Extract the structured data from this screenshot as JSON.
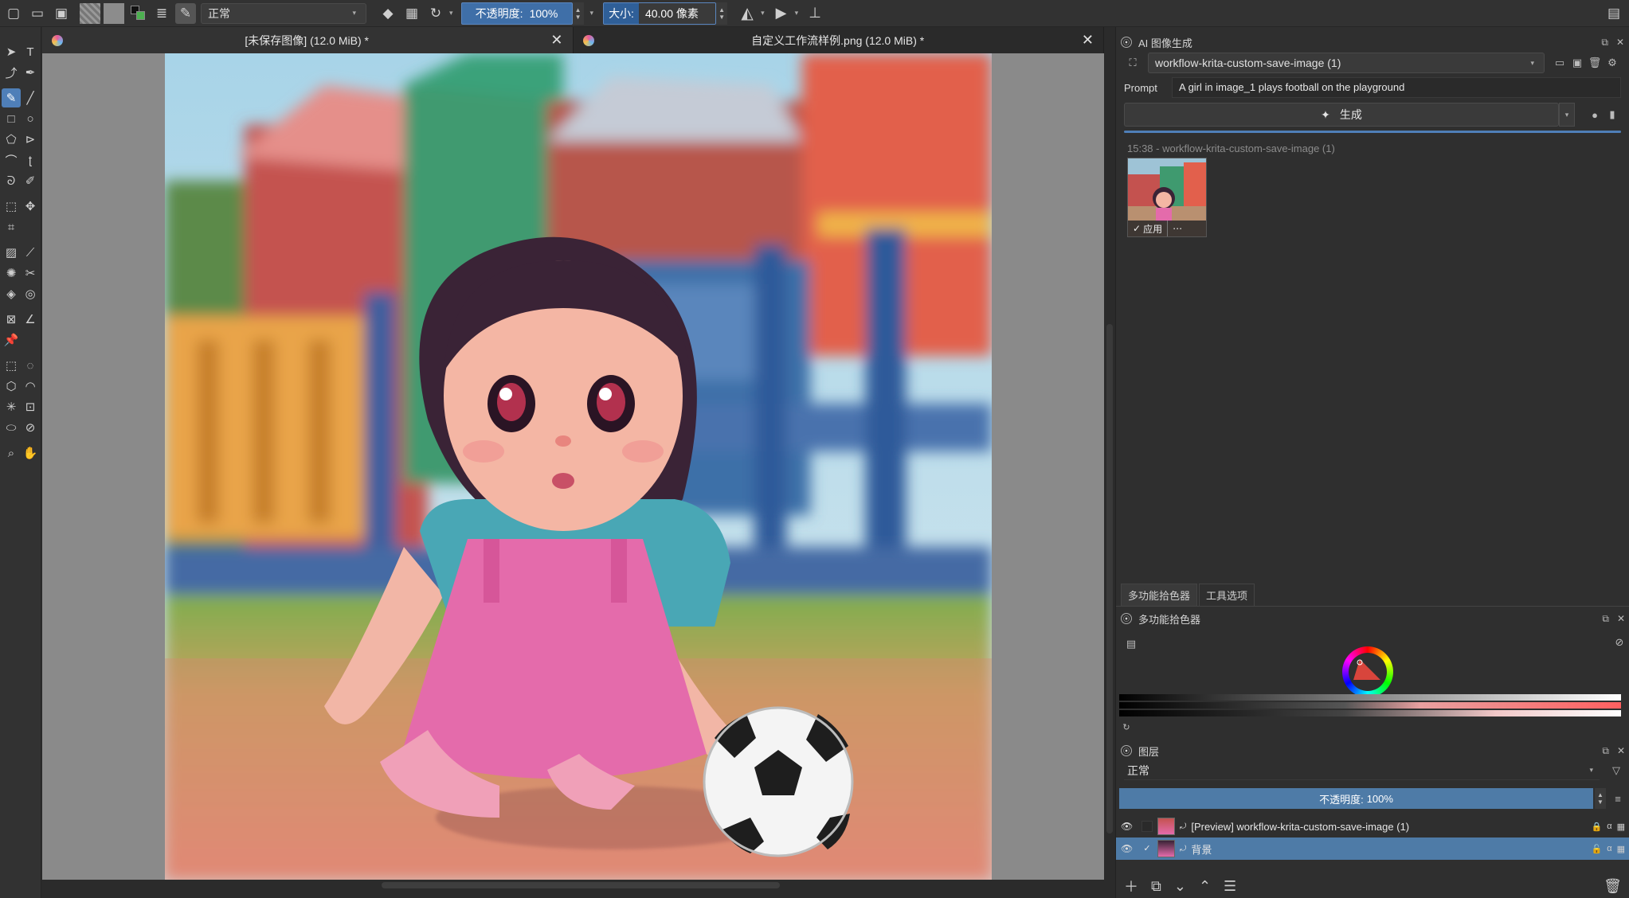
{
  "toolbar": {
    "blend_mode": "正常",
    "opacity_label": "不透明度:",
    "opacity_value": "100%",
    "size_label": "大小:",
    "size_value": "40.00 像素"
  },
  "tabs": [
    {
      "title": "[未保存图像] (12.0 MiB) *"
    },
    {
      "title": "自定义工作流样例.png (12.0 MiB) *"
    }
  ],
  "ai_panel": {
    "title": "AI 图像生成",
    "workflow": "workflow-krita-custom-save-image (1)",
    "prompt_label": "Prompt",
    "prompt_value": "A girl in image_1 plays football on the playground",
    "generate_label": "生成",
    "history_header": "15:38 - workflow-krita-custom-save-image (1)",
    "apply_label": "应用"
  },
  "dock_tabs": [
    "多功能拾色器",
    "工具选项"
  ],
  "color_docker": {
    "title": "多功能拾色器"
  },
  "layers": {
    "title": "图层",
    "blend_mode": "正常",
    "opacity_label": "不透明度:",
    "opacity_value": "100%",
    "items": [
      {
        "name": "[Preview] workflow-krita-custom-save-image (1)",
        "checked": "",
        "selected": false
      },
      {
        "name": "背景",
        "checked": "✓",
        "selected": true
      }
    ]
  },
  "colors": {
    "accent": "#4f7fb8",
    "selection": "#4e7ba7",
    "panel": "#2f2f2f",
    "canvas_bg": "#8a8a8a"
  }
}
